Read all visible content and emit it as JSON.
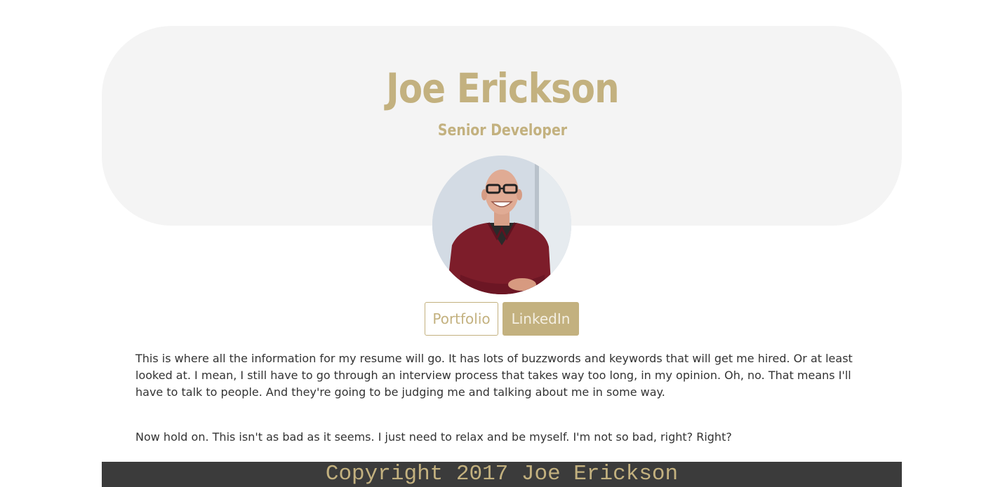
{
  "header": {
    "name": "Joe Erickson",
    "title": "Senior Developer"
  },
  "profile": {
    "avatar_icon": "profile-photo"
  },
  "links": {
    "portfolio_label": "Portfolio",
    "linkedin_label": "LinkedIn"
  },
  "bio": {
    "paragraph_1": "This is where all the information for my resume will go. It has lots of buzzwords and keywords that will get me hired. Or at least looked at. I mean, I still have to go through an interview process that takes way too long, in my opinion. Oh, no. That means I'll have to talk to people. And they're going to be judging me and talking about me in some way.",
    "paragraph_2": "Now hold on. This isn't as bad as it seems. I just need to relax and be myself. I'm not so bad, right? Right?"
  },
  "footer": {
    "copyright": "Copyright 2017 Joe Erickson"
  },
  "colors": {
    "accent": "#c3b17f",
    "hero_background": "#f4f4f4",
    "footer_background": "#3b3b3b",
    "body_text": "#333333"
  }
}
